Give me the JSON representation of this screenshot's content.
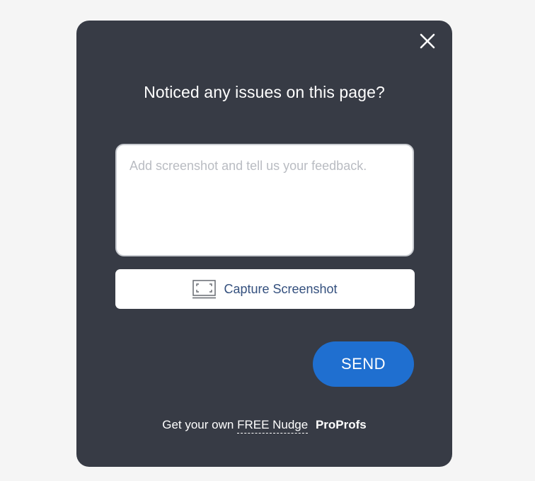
{
  "dialog": {
    "title": "Noticed any issues on this page?",
    "close_icon": "close-icon"
  },
  "feedback": {
    "placeholder": "Add screenshot and tell us your feedback.",
    "value": ""
  },
  "capture": {
    "label": "Capture Screenshot",
    "icon": "screenshot-icon"
  },
  "send": {
    "label": "SEND",
    "color": "#1f6fd0"
  },
  "footer": {
    "prefix": "Get your own",
    "link_text": "FREE Nudge",
    "brand": "ProProfs"
  },
  "colors": {
    "modal_bg": "#373b45",
    "page_bg": "#f5f5f5",
    "capture_text": "#34507e"
  }
}
